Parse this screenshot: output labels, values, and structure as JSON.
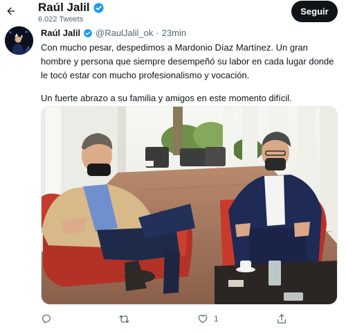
{
  "header": {
    "name": "Raúl Jalil",
    "tweet_count": "6.022 Tweets",
    "follow_label": "Seguir"
  },
  "tweet": {
    "author": "Raúl Jalil",
    "handle": "@RaulJalil_ok",
    "separator": "·",
    "time": "23min",
    "paragraphs": [
      "Con mucho pesar, despedimos a Mardonio Díaz Martínez. Un gran hombre y persona que siempre desempeñó su labor en cada lugar donde le tocó estar con mucho profesionalismo y vocación.",
      "Un fuerte abrazo a su familia y amigos en este momento difícil."
    ],
    "likes": "1"
  },
  "colors": {
    "text": "#0f1419",
    "secondary": "#536471",
    "verified": "#1d9bf0",
    "follow_bg": "#0f1419"
  },
  "icons": [
    "back-arrow-icon",
    "verified-badge-icon",
    "reply-icon",
    "retweet-icon",
    "like-icon",
    "share-icon"
  ]
}
